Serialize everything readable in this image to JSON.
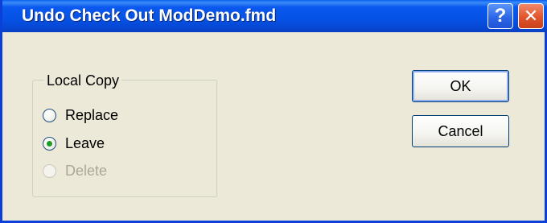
{
  "window": {
    "title": "Undo Check Out ModDemo.fmd",
    "help_label": "?",
    "close_label": "✕"
  },
  "local_copy": {
    "group_label": "Local Copy",
    "options": [
      {
        "label": "Replace",
        "checked": false,
        "enabled": true
      },
      {
        "label": "Leave",
        "checked": true,
        "enabled": true
      },
      {
        "label": "Delete",
        "checked": false,
        "enabled": false
      }
    ]
  },
  "buttons": {
    "ok_label": "OK",
    "cancel_label": "Cancel"
  },
  "colors": {
    "titlebar_blue": "#0a58ee",
    "dialog_bg": "#ece9d8",
    "close_red": "#e2542c",
    "radio_selected_green": "#1e9b22",
    "disabled_text": "#aca899"
  }
}
